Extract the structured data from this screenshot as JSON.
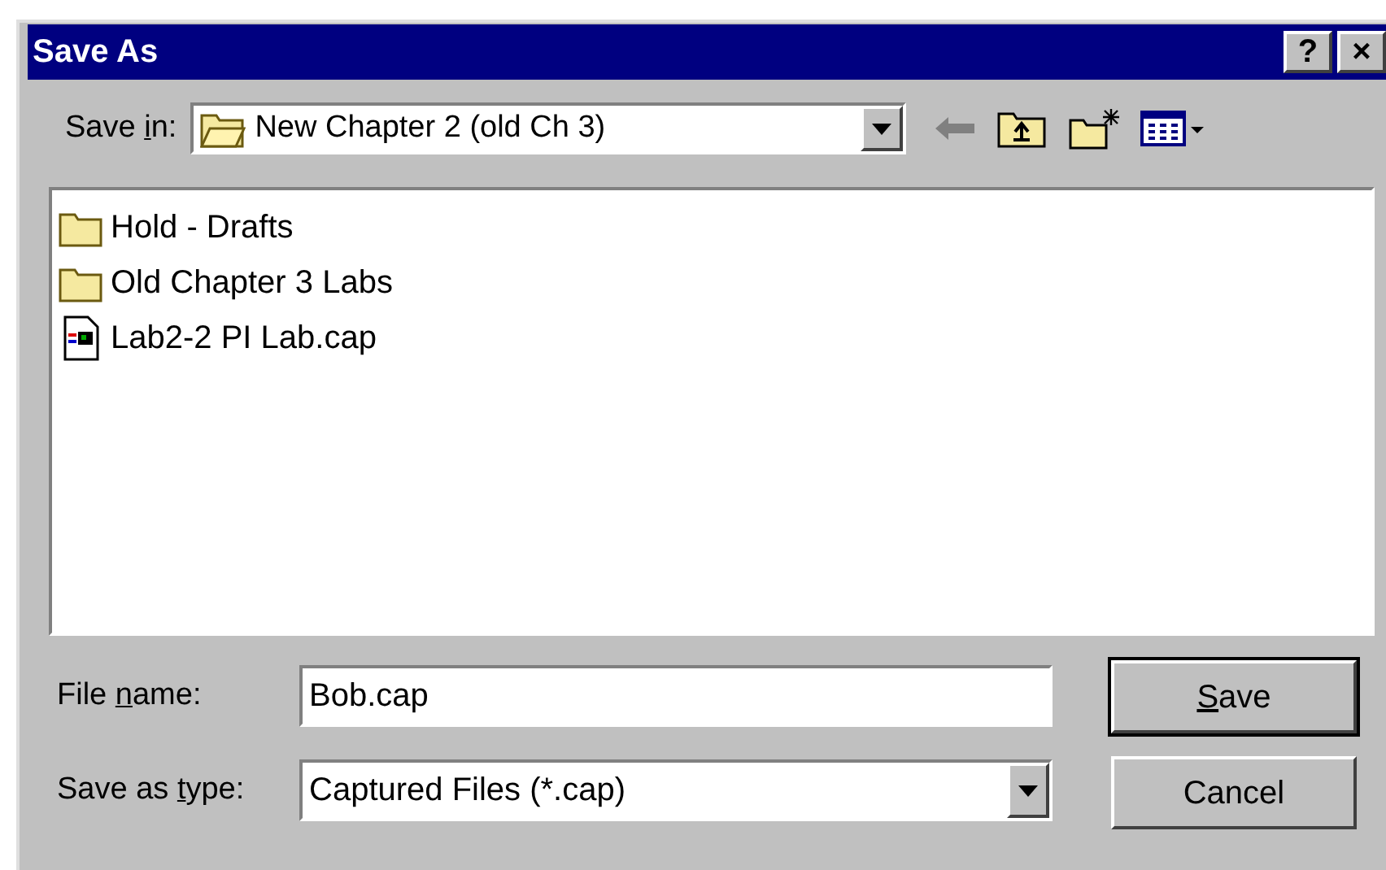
{
  "window": {
    "title": "Save As",
    "buttons": [
      "?",
      "×"
    ]
  },
  "save_in": {
    "label": {
      "before": "Save ",
      "key": "i",
      "after": "n:"
    },
    "value": "New Chapter 2 (old Ch 3)"
  },
  "files": [
    {
      "name": "Hold - Drafts",
      "kind": "folder"
    },
    {
      "name": "Old Chapter 3 Labs",
      "kind": "folder"
    },
    {
      "name": "Lab2-2 PI Lab.cap",
      "kind": "capture"
    }
  ],
  "file_name": {
    "label": {
      "before": "File ",
      "key": "n",
      "after": "ame:"
    },
    "value": "Bob.cap"
  },
  "save_as_type": {
    "label": {
      "before": "Save as ",
      "key": "t",
      "after": "ype:"
    },
    "value": "Captured Files (*.cap)"
  },
  "buttons": [
    {
      "label": {
        "key": "S",
        "after": "ave"
      },
      "default": true
    },
    {
      "label": {
        "before": "Cancel"
      },
      "default": false
    }
  ]
}
